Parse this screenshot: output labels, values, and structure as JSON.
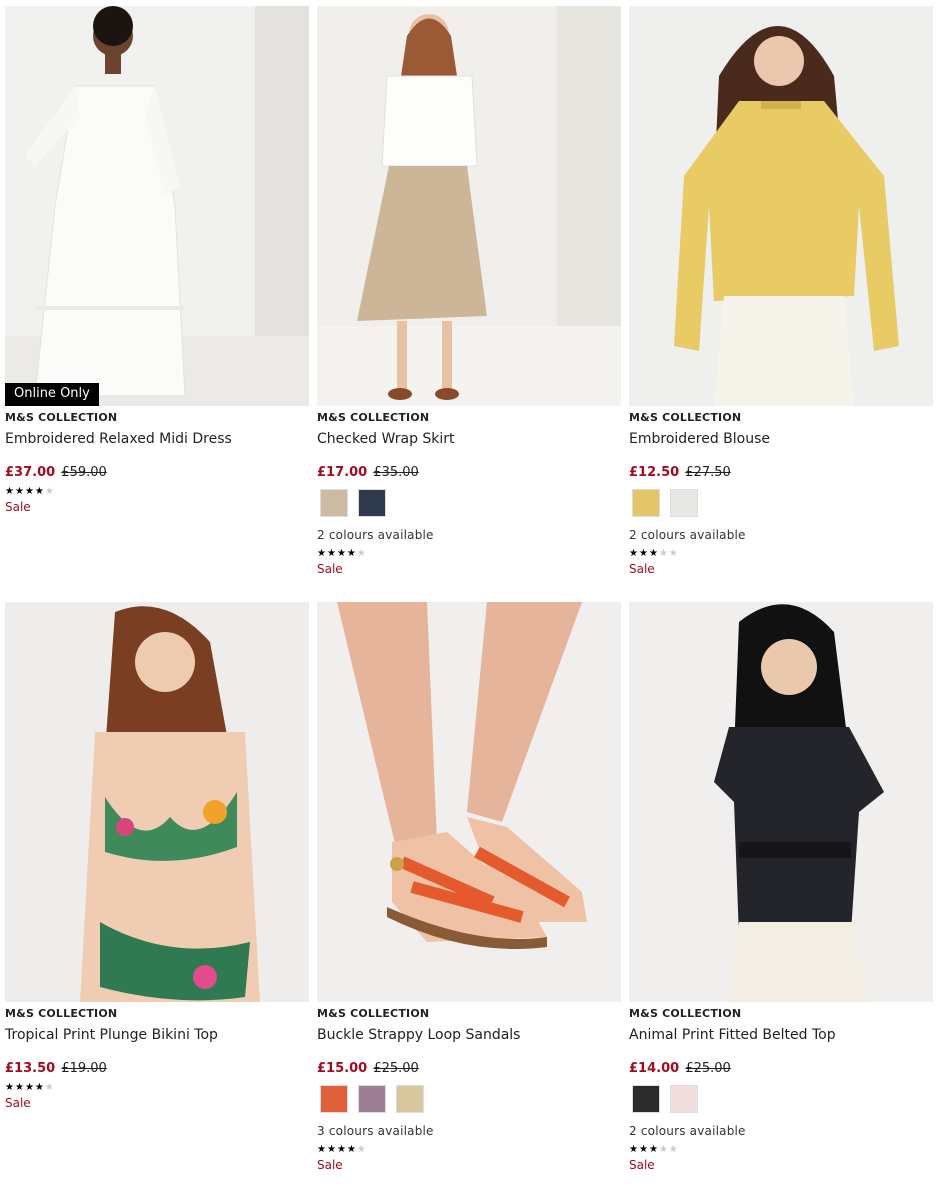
{
  "products": [
    {
      "badge": "Online Only",
      "brand": "M&S COLLECTION",
      "title": "Embroidered Relaxed Midi Dress",
      "price_now": "£37.00",
      "price_was": "£59.00",
      "rating": 3.5,
      "swatches": [],
      "colours_text": "",
      "sale": "Sale",
      "image": "white-midi-dress"
    },
    {
      "badge": "",
      "brand": "M&S COLLECTION",
      "title": "Checked Wrap Skirt",
      "price_now": "£17.00",
      "price_was": "£35.00",
      "rating": 4,
      "swatches": [
        "#cdbba3",
        "#2f3a4e"
      ],
      "colours_text": "2 colours available",
      "sale": "Sale",
      "image": "checked-wrap-skirt"
    },
    {
      "badge": "",
      "brand": "M&S COLLECTION",
      "title": "Embroidered Blouse",
      "price_now": "£12.50",
      "price_was": "£27.50",
      "rating": 3,
      "swatches": [
        "#e3c56a",
        "#e8e8e4"
      ],
      "colours_text": "2 colours available",
      "sale": "Sale",
      "image": "yellow-blouse"
    },
    {
      "badge": "",
      "brand": "M&S COLLECTION",
      "title": "Tropical Print Plunge Bikini Top",
      "price_now": "£13.50",
      "price_was": "£19.00",
      "rating": 4,
      "swatches": [],
      "colours_text": "",
      "sale": "Sale",
      "image": "tropical-bikini"
    },
    {
      "badge": "",
      "brand": "M&S COLLECTION",
      "title": "Buckle Strappy Loop Sandals",
      "price_now": "£15.00",
      "price_was": "£25.00",
      "rating": 4,
      "swatches": [
        "#e0603a",
        "#9c7f95",
        "#d9c7a0"
      ],
      "colours_text": "3 colours available",
      "sale": "Sale",
      "image": "orange-sandals"
    },
    {
      "badge": "",
      "brand": "M&S COLLECTION",
      "title": "Animal Print Fitted Belted Top",
      "price_now": "£14.00",
      "price_was": "£25.00",
      "rating": 3,
      "swatches": [
        "#2b2b2b",
        "#f1dede"
      ],
      "colours_text": "2 colours available",
      "sale": "Sale",
      "image": "animal-print-top"
    }
  ]
}
